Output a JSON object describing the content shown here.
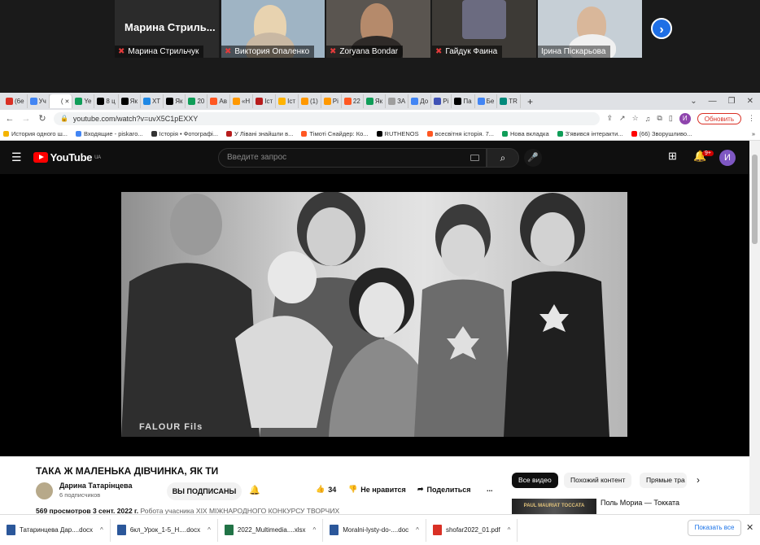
{
  "zoom": {
    "featured_name": "Марина  Стриль...",
    "participants": [
      {
        "name": "Марина Стрильчук"
      },
      {
        "name": "Виктория Опаленко"
      },
      {
        "name": "Zoryana Bondar"
      },
      {
        "name": "Гайдук Фаина"
      },
      {
        "name": "Ірина Піскарьова"
      }
    ],
    "next_icon": "chevron-right-icon"
  },
  "browser": {
    "tabs": [
      {
        "label": "(6е",
        "color": "#d93025"
      },
      {
        "label": "Уч",
        "color": "#4285f4"
      },
      {
        "label": "(",
        "color": "#ffffff",
        "active": true
      },
      {
        "label": "Ye",
        "color": "#0f9d58"
      },
      {
        "label": "8 ц",
        "color": "#000000"
      },
      {
        "label": "Як",
        "color": "#000000"
      },
      {
        "label": "ХТ",
        "color": "#1e88e5"
      },
      {
        "label": "Як",
        "color": "#000000"
      },
      {
        "label": "20",
        "color": "#0f9d58"
      },
      {
        "label": "Ав",
        "color": "#ff5722"
      },
      {
        "label": "«Н",
        "color": "#ff9800"
      },
      {
        "label": "Іст",
        "color": "#b71c1c"
      },
      {
        "label": "Іст",
        "color": "#ffb300"
      },
      {
        "label": "(1)",
        "color": "#ff9800"
      },
      {
        "label": "Рі",
        "color": "#ff9800"
      },
      {
        "label": "22",
        "color": "#ff5722"
      },
      {
        "label": "Як",
        "color": "#0f9d58"
      },
      {
        "label": "ЗА",
        "color": "#9e9e9e"
      },
      {
        "label": "До",
        "color": "#4285f4"
      },
      {
        "label": "Рі",
        "color": "#3f51b5"
      },
      {
        "label": "Па",
        "color": "#000000"
      },
      {
        "label": "Бе",
        "color": "#4285f4"
      },
      {
        "label": "TR",
        "color": "#00897b"
      }
    ],
    "new_tab": "+",
    "url": "youtube.com/watch?v=uvX5C1pEXXY",
    "profile_initial": "И",
    "update_label": "Обновить",
    "bookmarks": [
      "История одного ш...",
      "Входящие - piskaro...",
      "Історія • Фотографі...",
      "У Лівані знайшли в...",
      "Тімоті Снайдер: Ко...",
      "RUTHENOS",
      "всесвітня історія. 7...",
      "Нова вкладка",
      "З'явився інтеракти...",
      "(66) Зворушливо..."
    ],
    "bookmarks_more": "»"
  },
  "youtube": {
    "logo_text": "YouTube",
    "logo_region": "UA",
    "search_placeholder": "Введите запрос",
    "notifications_count": "9+",
    "avatar_initial": "И",
    "video": {
      "watermark": "FALOUR Fils",
      "title": "ТАКА Ж МАЛЕНЬКА ДІВЧИНКА, ЯК ТИ",
      "channel": "Дарина Татарінцева",
      "subscribers": "6 подписчиков",
      "subscribe_label": "ВЫ ПОДПИСАНЫ",
      "likes": "34",
      "dislike_label": "Не нравится",
      "share_label": "Поделиться",
      "more_label": "...",
      "views_date": "569 просмотров  3 сент. 2022 г.",
      "description": "Робота учасника XIX МІЖНАРОДНОГО КОНКУРСУ ТВОРЧИХ"
    },
    "chips": [
      "Все видео",
      "Похожий контент",
      "Прямые тра"
    ],
    "recommended": {
      "title": "Поль Мориа — Токката",
      "thumb_text": "PAUL MAURIAT TOCCATA"
    }
  },
  "downloads": {
    "items": [
      {
        "name": "Татаринцева Дар....docx",
        "color": "#2b579a"
      },
      {
        "name": "6кл_Урок_1-5_Н....docx",
        "color": "#2b579a"
      },
      {
        "name": "2022_Multimedia....xlsx",
        "color": "#217346"
      },
      {
        "name": "Moralni-lysty-do-....doc",
        "color": "#2b579a"
      },
      {
        "name": "shofar2022_01.pdf",
        "color": "#d93025"
      }
    ],
    "show_all": "Показать все",
    "close": "✕"
  }
}
